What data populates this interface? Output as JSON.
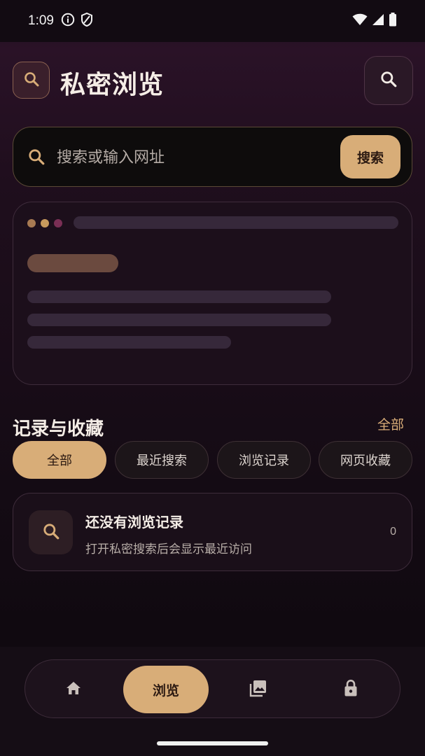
{
  "status_bar": {
    "time": "1:09",
    "icons": [
      "info-icon",
      "shield-icon",
      "wifi-icon",
      "signal-icon",
      "battery-icon"
    ]
  },
  "header": {
    "title": "私密浏览",
    "logo_icon": "search-icon",
    "action_icon": "search-icon"
  },
  "search": {
    "placeholder": "搜索或输入网址",
    "value": "",
    "button_label": "搜索"
  },
  "preview": {
    "dot_colors": [
      "#a77a52",
      "#c79a5d",
      "#7a2f55"
    ]
  },
  "records": {
    "title": "记录与收藏",
    "view_all": "全部",
    "chips": [
      {
        "label": "全部",
        "active": true
      },
      {
        "label": "最近搜索",
        "active": false
      },
      {
        "label": "浏览记录",
        "active": false
      },
      {
        "label": "网页收藏",
        "active": false
      }
    ],
    "empty": {
      "title": "还没有浏览记录",
      "subtitle": "打开私密搜索后会显示最近访问",
      "count": "0"
    }
  },
  "bottom_nav": {
    "items": [
      {
        "icon": "home-icon",
        "label": "",
        "active": false
      },
      {
        "icon": "",
        "label": "浏览",
        "active": true
      },
      {
        "icon": "gallery-icon",
        "label": "",
        "active": false
      },
      {
        "icon": "lock-icon",
        "label": "",
        "active": false
      }
    ]
  },
  "colors": {
    "accent": "#d8ad78",
    "background": "#120a12",
    "card": "#1c0f1b"
  }
}
